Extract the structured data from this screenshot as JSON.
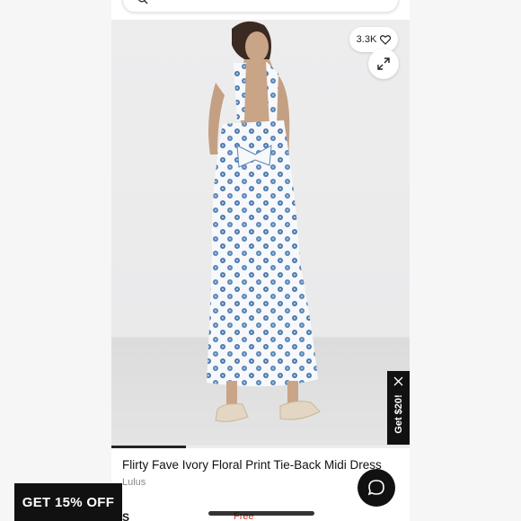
{
  "header": {
    "search_icon": "search-icon"
  },
  "gallery": {
    "likes_count": "3.3K",
    "likes_icon": "heart-outline-icon",
    "expand_icon": "expand-icon",
    "progress": 0.25
  },
  "product": {
    "title": "Flirty Fave Ivory Floral Print Tie-Back Midi Dress",
    "brand": "Lulus",
    "price_partial": "S",
    "shipping_partial": "Free"
  },
  "promo_tab": {
    "label": "Get $20!",
    "close_icon": "close-icon"
  },
  "chat": {
    "icon": "chat-bubble-icon"
  },
  "discount_banner": {
    "label": "GET 15% OFF"
  },
  "colors": {
    "dark": "#111111",
    "accent_red": "#c0392b",
    "dress_print": "#5a86b5"
  }
}
